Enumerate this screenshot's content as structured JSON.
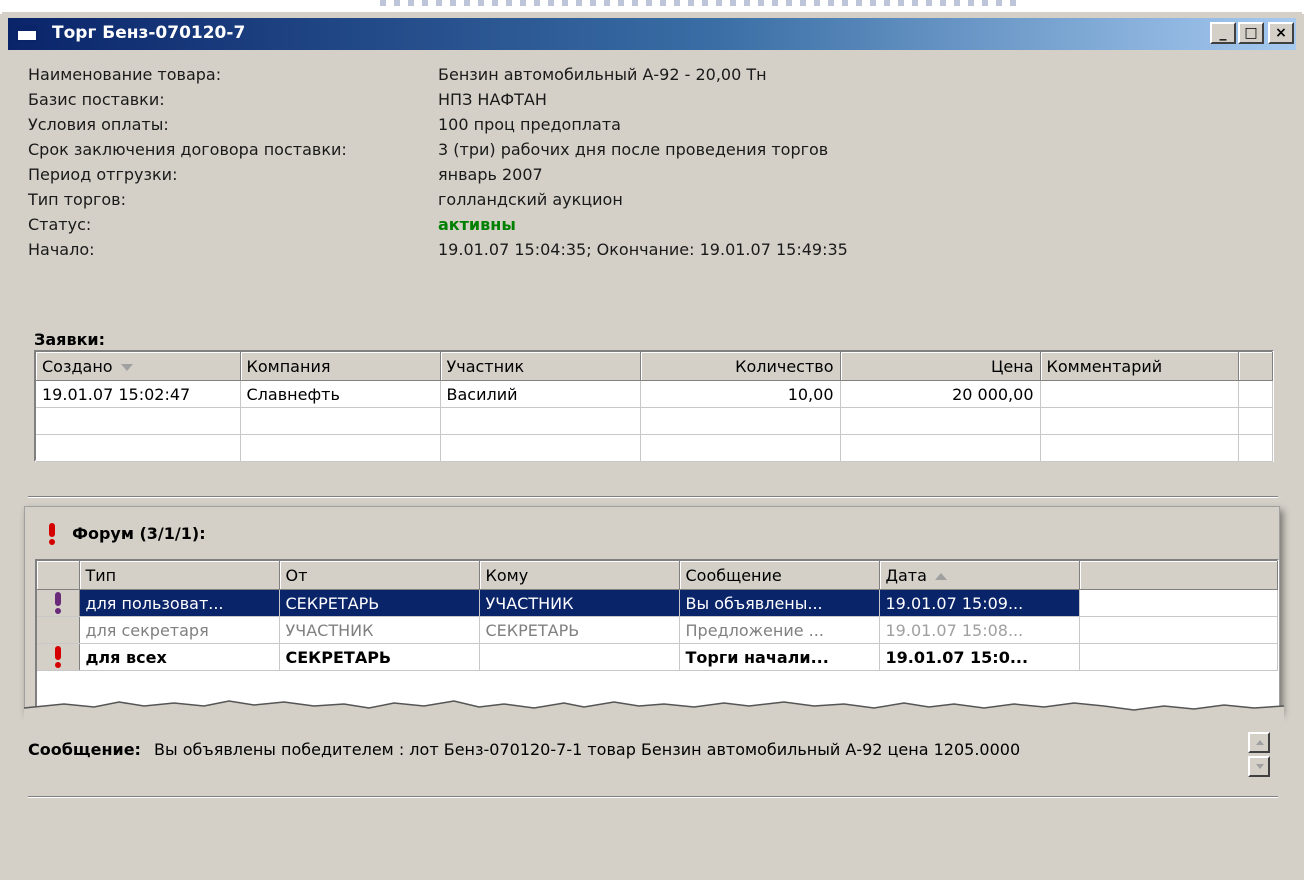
{
  "window": {
    "title": "Торг Бенз-070120-7",
    "min_label": "_",
    "max_label": "□",
    "close_label": "×"
  },
  "info": {
    "rows": [
      {
        "label": "Наименование товара:",
        "value": "Бензин автомобильный А-92 - 20,00 Тн"
      },
      {
        "label": "Базис поставки:",
        "value": "НПЗ НАФТАН"
      },
      {
        "label": "Условия оплаты:",
        "value": "100 проц предоплата"
      },
      {
        "label": "Срок заключения договора поставки:",
        "value": "3 (три) рабочих дня после проведения торгов"
      },
      {
        "label": "Период отгрузки:",
        "value": "январь 2007"
      },
      {
        "label": "Тип торгов:",
        "value": "голландский аукцион"
      },
      {
        "label": "Статус:",
        "value": "активны"
      },
      {
        "label": "Начало:",
        "value": "19.01.07 15:04:35;   Окончание: 19.01.07 15:49:35"
      }
    ],
    "status_color": "#008000"
  },
  "bids": {
    "title": "Заявки:",
    "columns": [
      "Создано",
      "Компания",
      "Участник",
      "Количество",
      "Цена",
      "Комментарий"
    ],
    "rows": [
      [
        "19.01.07 15:02:47",
        "Славнефть",
        "Василий",
        "10,00",
        "20 000,00",
        ""
      ]
    ]
  },
  "forum": {
    "title": "Форум (3/1/1):",
    "columns": [
      "Тип",
      "От",
      "Кому",
      "Сообщение",
      "Дата"
    ],
    "rows": [
      [
        "для пользоват...",
        "СЕКРЕТАРЬ",
        "УЧАСТНИК",
        "Вы объявлены...",
        "19.01.07 15:09..."
      ],
      [
        "для секретаря",
        "УЧАСТНИК",
        "СЕКРЕТАРЬ",
        "Предложение ...",
        "19.01.07 15:08..."
      ],
      [
        "для всех",
        "СЕКРЕТАРЬ",
        "",
        "Торги начали...",
        "19.01.07 15:0..."
      ]
    ],
    "selection_color": "#0a246a",
    "alert_color": "#d40000"
  },
  "message": {
    "label": "Сообщение:",
    "text": "Вы объявлены победителем : лот Бенз-070120-7-1 товар Бензин автомобильный А-92 цена 1205.0000"
  }
}
